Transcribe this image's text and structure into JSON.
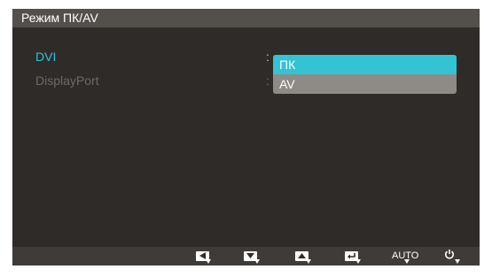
{
  "window": {
    "title": "Режим ПК/AV"
  },
  "menu": {
    "items": [
      {
        "label": "DVI",
        "state": "selected"
      },
      {
        "label": "DisplayPort",
        "state": "disabled"
      }
    ],
    "separator": ":"
  },
  "dropdown": {
    "options": [
      {
        "label": "ПК",
        "active": true
      },
      {
        "label": "AV",
        "active": false
      }
    ]
  },
  "bottom_keys": [
    {
      "icon": "left-arrow-icon"
    },
    {
      "icon": "down-arrow-icon"
    },
    {
      "icon": "up-arrow-icon"
    },
    {
      "icon": "enter-icon"
    },
    {
      "label": "AUTO"
    },
    {
      "icon": "power-icon"
    }
  ],
  "colors": {
    "accent": "#33c3d3",
    "panel": "#2e2b28",
    "title_bar": "#53504c",
    "dropdown": "#8e8b86",
    "disabled_text": "#6e6a65"
  }
}
